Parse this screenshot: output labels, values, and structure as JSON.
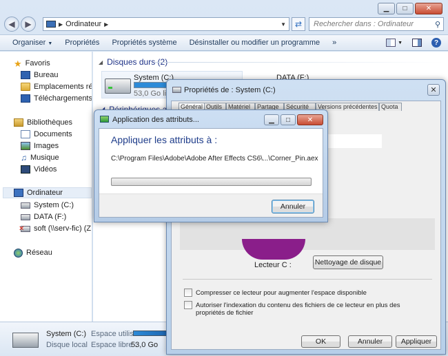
{
  "address": {
    "path": "Ordinateur",
    "search_placeholder": "Rechercher dans : Ordinateur"
  },
  "toolbar": {
    "organize": "Organiser",
    "items": [
      "Propriétés",
      "Propriétés système",
      "Désinstaller ou modifier un programme"
    ],
    "more": "»"
  },
  "nav": {
    "favorites": "Favoris",
    "desktop": "Bureau",
    "recent": "Emplacements récents",
    "downloads": "Téléchargements",
    "libraries": "Bibliothèques",
    "documents": "Documents",
    "images": "Images",
    "music": "Musique",
    "videos": "Vidéos",
    "computer": "Ordinateur",
    "drive_c": "System (C:)",
    "drive_f": "DATA (F:)",
    "drive_z": "soft (\\\\serv-fic) (Z:)",
    "network": "Réseau"
  },
  "content": {
    "hard_disks_header": "Disques durs (2)",
    "drive_c_name": "System (C:)",
    "drive_c_free": "53,0 Go libres sur 100 Go",
    "drive_c_used_fraction": 0.47,
    "drive_f_name": "DATA (F:)",
    "removable_header": "Périphériques avec stockage amovible"
  },
  "details": {
    "name": "System (C:)",
    "type": "Disque local",
    "used_label": "Espace utilisé :",
    "free_label": "Espace libre :",
    "free_value": "53,0 Go"
  },
  "props": {
    "title": "Propriétés de : System (C:)",
    "tabs": [
      "Général",
      "Outils",
      "Matériel",
      "Partage",
      "Sécurité",
      "Versions précédentes",
      "Quota"
    ],
    "drive_label": "Lecteur C :",
    "cleanup_button": "Nettoyage de disque",
    "compress_label": "Compresser ce lecteur pour augmenter l'espace disponible",
    "index_label_1": "Autoriser l'indexation du contenu des fichiers de ce lecteur en plus des",
    "index_label_2": "propriétés de fichier",
    "ok": "OK",
    "cancel": "Annuler",
    "apply": "Appliquer"
  },
  "apply_dialog": {
    "title": "Application des attributs...",
    "heading": "Appliquer les attributs à :",
    "path": "C:\\Program Files\\Adobe\\Adobe After Effects CS6\\...\\Corner_Pin.aex",
    "cancel": "Annuler"
  },
  "colors": {
    "heading_blue": "#1e3c8a",
    "progress_blue": "#2c8ad8",
    "pie_used": "#8a1e8a"
  }
}
